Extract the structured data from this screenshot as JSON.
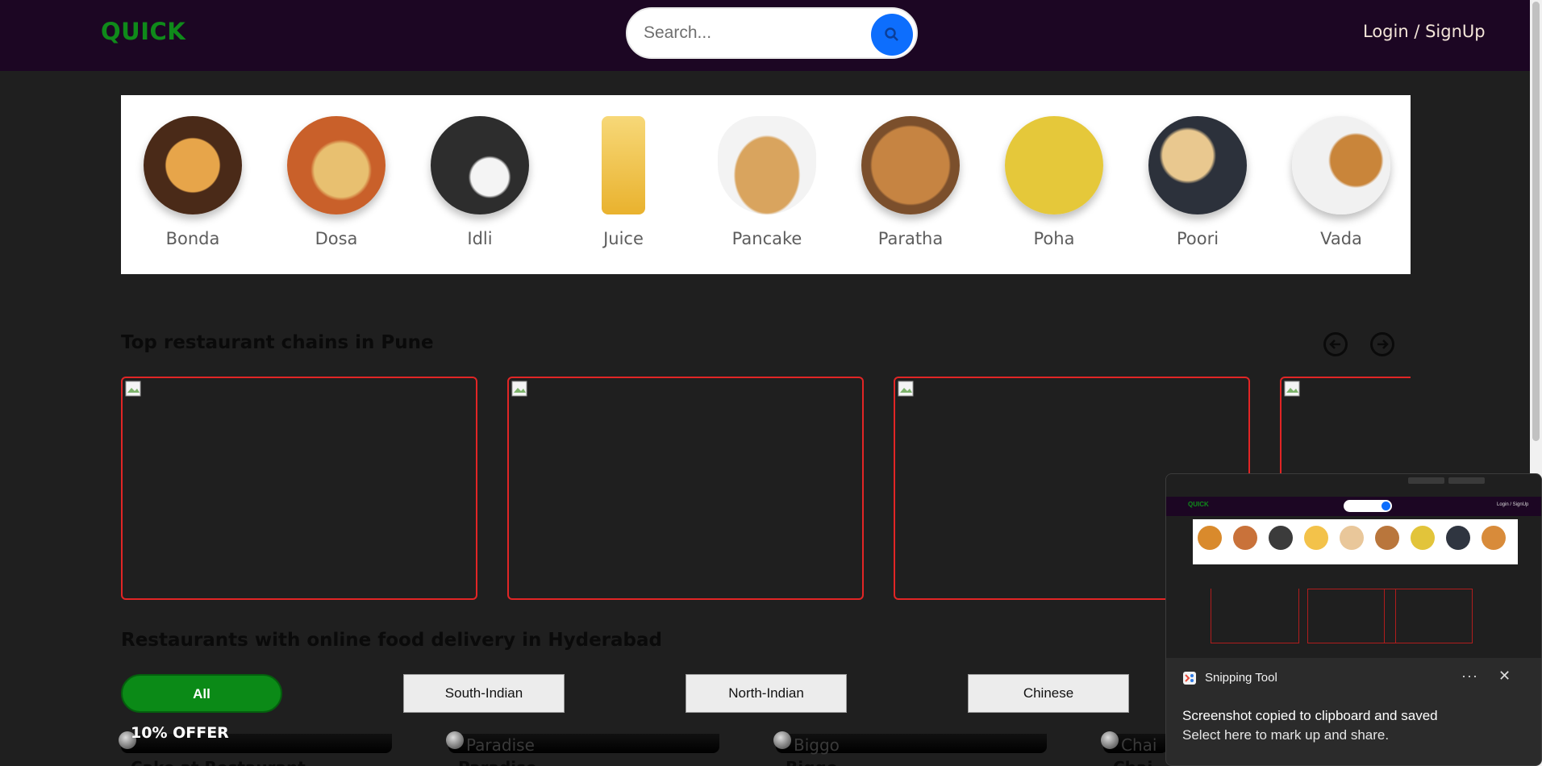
{
  "header": {
    "logo": "QUICK",
    "search_placeholder": "Search...",
    "login_label": "Login / SignUp"
  },
  "categories": [
    {
      "label": "Bonda",
      "color": "#d98a2c"
    },
    {
      "label": "Dosa",
      "color": "#c9723a"
    },
    {
      "label": "Idli",
      "color": "#3b3b3b"
    },
    {
      "label": "Juice",
      "color": "#f3c24a"
    },
    {
      "label": "Pancake",
      "color": "#e9c79a"
    },
    {
      "label": "Paratha",
      "color": "#b9763c"
    },
    {
      "label": "Poha",
      "color": "#e2c43a"
    },
    {
      "label": "Poori",
      "color": "#2f3540"
    },
    {
      "label": "Vada",
      "color": "#d88b3a"
    }
  ],
  "sections": {
    "chains_title": "Top restaurant chains in Pune",
    "delivery_title": "Restaurants with online food delivery in Hyderabad"
  },
  "filters": {
    "all": "All",
    "south": "South-Indian",
    "north": "North-Indian",
    "chinese": "Chinese"
  },
  "restaurants": [
    {
      "name": "",
      "offer": "10% OFFER",
      "subtitle": "Cake at Restaurant"
    },
    {
      "name": "Paradise",
      "subtitle": "Paradise"
    },
    {
      "name": "Biggo",
      "subtitle": "Biggo"
    },
    {
      "name": "Chai",
      "subtitle": "Chai"
    }
  ],
  "toast": {
    "app_name": "Snipping Tool",
    "more": "···",
    "close": "✕",
    "message": "Screenshot copied to clipboard and saved",
    "sub_message": "Select here to mark up and share."
  },
  "colors": {
    "header_bg": "#1c0623",
    "brand": "#0f8a1a",
    "accent": "#0d6efd",
    "card_border": "#e12525",
    "page_bg": "#1f1f1f"
  }
}
